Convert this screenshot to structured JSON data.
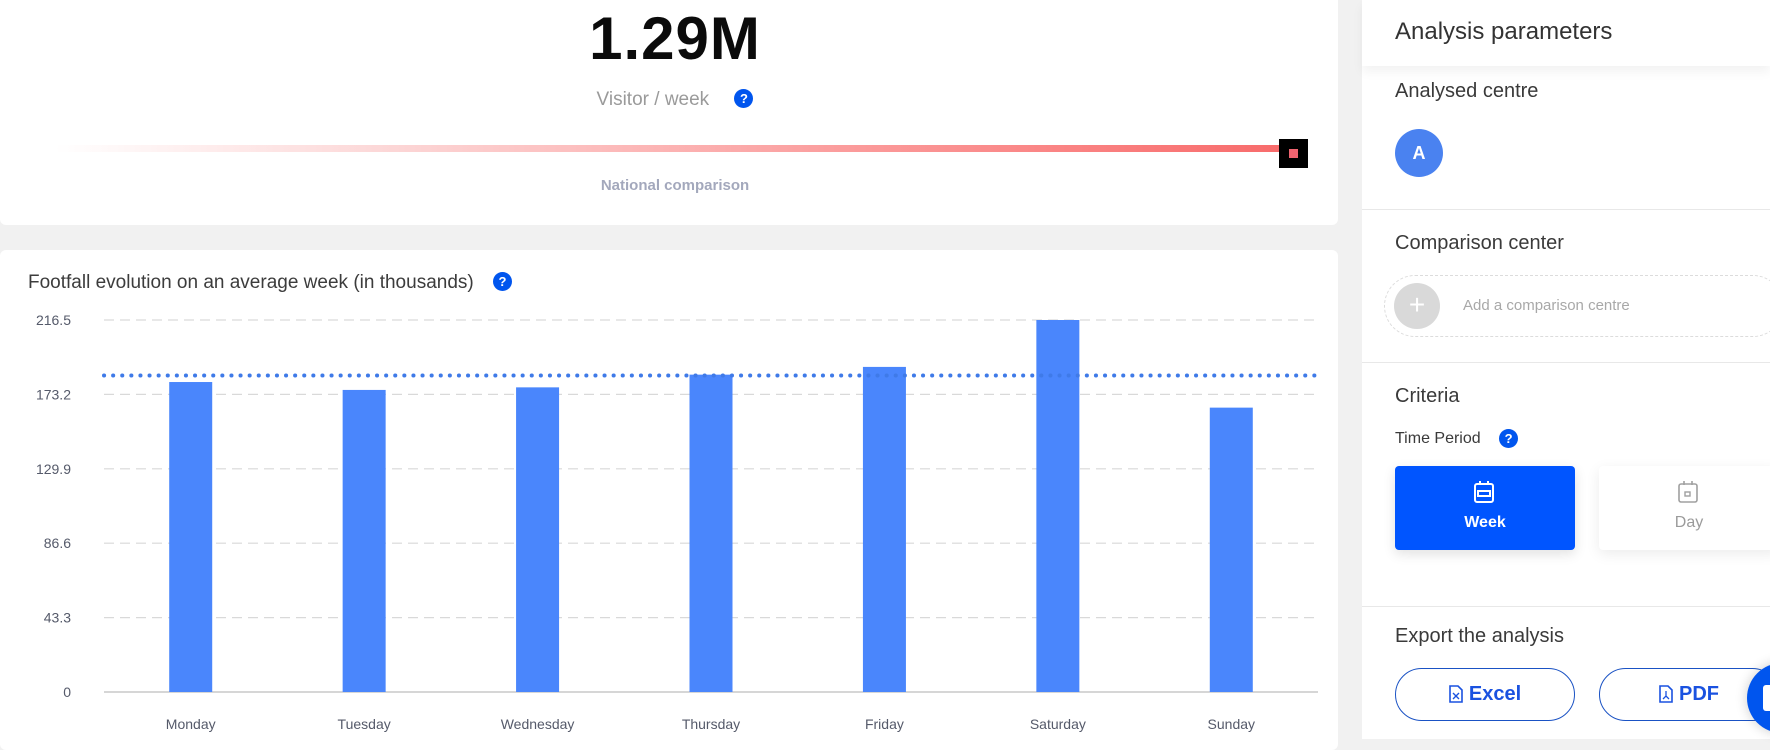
{
  "kpi": {
    "value": "1.29M",
    "unit_label": "Visitor / week",
    "help_icon": "?",
    "gauge_label": "National comparison",
    "gauge_position_pct": 100
  },
  "chart_section": {
    "title": "Footfall evolution on an average week (in thousands)",
    "help_icon": "?"
  },
  "chart_data": {
    "type": "bar",
    "title": "Footfall evolution on an average week (in thousands)",
    "xlabel": "",
    "ylabel": "",
    "categories": [
      "Monday",
      "Tuesday",
      "Wednesday",
      "Thursday",
      "Friday",
      "Saturday",
      "Sunday"
    ],
    "values": [
      180.4,
      175.8,
      177.3,
      184.7,
      189.2,
      216.5,
      165.5
    ],
    "average_line": 184.2,
    "yticks": [
      "0",
      "43.3",
      "86.6",
      "129.9",
      "173.2",
      "216.5"
    ],
    "ylim": [
      0,
      216.5
    ],
    "grid": true,
    "bar_color": "#4a86fc",
    "average_color": "#3f7ae8"
  },
  "panel": {
    "title": "Analysis parameters",
    "analysed_centre": {
      "title": "Analysed centre",
      "avatar_letter": "A"
    },
    "comparison": {
      "title": "Comparison center",
      "add_icon": "+",
      "add_label": "Add a comparison centre"
    },
    "criteria": {
      "title": "Criteria",
      "time_period_label": "Time Period",
      "help_icon": "?",
      "options": [
        {
          "label": "Week",
          "selected": true
        },
        {
          "label": "Day",
          "selected": false
        }
      ]
    },
    "export": {
      "title": "Export the analysis",
      "excel_label": "Excel",
      "pdf_label": "PDF"
    }
  },
  "colors": {
    "accent": "#0055ff",
    "gauge_end": "#f86a6a"
  }
}
